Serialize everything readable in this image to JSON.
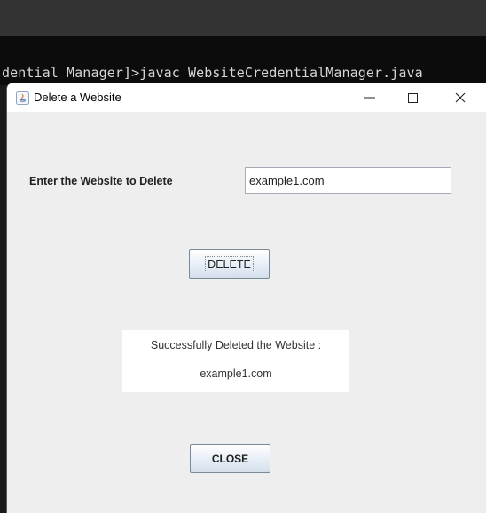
{
  "terminal": {
    "command_line": "dential Manager]>javac WebsiteCredentialManager.java"
  },
  "window": {
    "title": "Delete a Website",
    "minimize_glyph": "—",
    "maximize_glyph": "☐",
    "close_glyph": "✕"
  },
  "form": {
    "label": "Enter the Website to Delete",
    "input_value": "example1.com",
    "delete_button": "DELETE"
  },
  "result": {
    "message": "Successfully Deleted the Website :",
    "website": "example1.com"
  },
  "footer": {
    "close_button": "CLOSE"
  },
  "icons": {
    "app": "java-icon",
    "minimize": "minimize-icon",
    "maximize": "maximize-icon",
    "close": "close-icon"
  },
  "colors": {
    "window_bg": "#eeeeee",
    "titlebar_bg": "#ffffff",
    "terminal_bg": "#0c0c0c",
    "terminal_text": "#d6d6d6"
  }
}
